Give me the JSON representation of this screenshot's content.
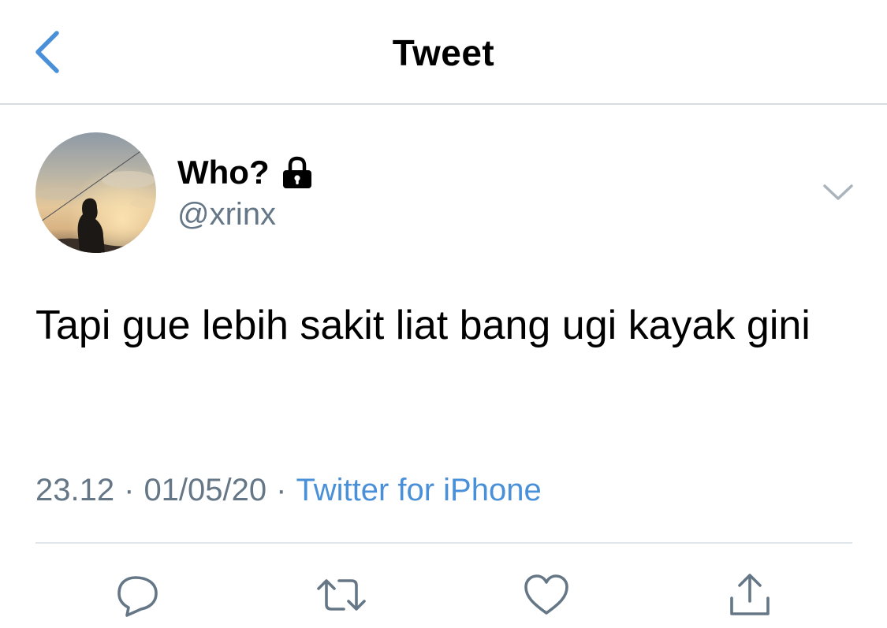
{
  "header": {
    "title": "Tweet",
    "back_icon": "chevron-left-icon",
    "accent_color": "#4a90d9"
  },
  "author": {
    "name": "Who?",
    "handle": "@xrinx",
    "protected_icon": "lock-icon",
    "avatar_icon": "avatar-photo"
  },
  "tweet": {
    "text": "Tapi gue lebih sakit liat bang ugi kayak gini"
  },
  "meta": {
    "time": "23.12",
    "separator": "·",
    "date": "01/05/20",
    "source": "Twitter for iPhone"
  },
  "actions": [
    {
      "name": "reply",
      "icon": "reply-icon"
    },
    {
      "name": "retweet",
      "icon": "retweet-icon"
    },
    {
      "name": "like",
      "icon": "heart-icon"
    },
    {
      "name": "share",
      "icon": "share-icon"
    }
  ],
  "colors": {
    "secondary_text": "#657786",
    "link": "#4a90d9",
    "divider": "#e1e6ea"
  }
}
